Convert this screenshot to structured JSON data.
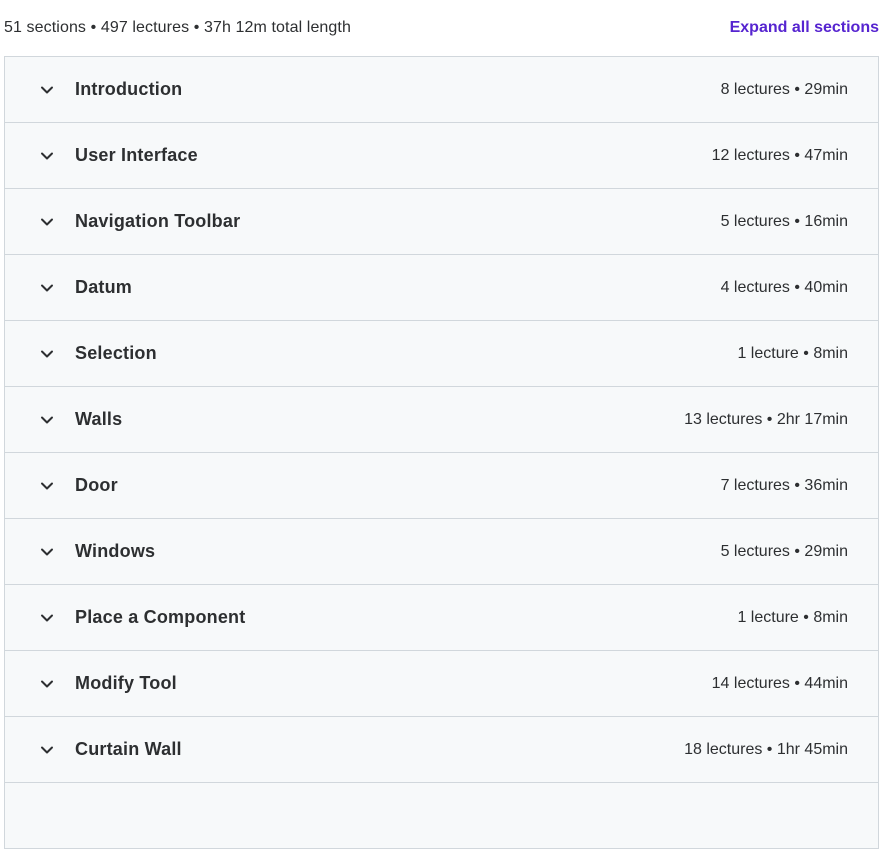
{
  "summary": {
    "text": "51 sections • 497 lectures • 37h 12m total length",
    "expand_label": "Expand all sections"
  },
  "colors": {
    "link": "#5624d0",
    "row_bg": "#f7f9fa",
    "border": "#d1d7dc",
    "text": "#2d2f31"
  },
  "icons": {
    "row_toggle": "chevron-down-icon"
  },
  "sections": [
    {
      "title": "Introduction",
      "meta": "8 lectures • 29min"
    },
    {
      "title": "User Interface",
      "meta": "12 lectures • 47min"
    },
    {
      "title": "Navigation Toolbar",
      "meta": "5 lectures • 16min"
    },
    {
      "title": "Datum",
      "meta": "4 lectures • 40min"
    },
    {
      "title": "Selection",
      "meta": "1 lecture • 8min"
    },
    {
      "title": "Walls",
      "meta": "13 lectures • 2hr 17min"
    },
    {
      "title": "Door",
      "meta": "7 lectures • 36min"
    },
    {
      "title": "Windows",
      "meta": "5 lectures • 29min"
    },
    {
      "title": "Place a Component",
      "meta": "1 lecture • 8min"
    },
    {
      "title": "Modify Tool",
      "meta": "14 lectures • 44min"
    },
    {
      "title": "Curtain Wall",
      "meta": "18 lectures • 1hr 45min"
    },
    {
      "title": "",
      "meta": ""
    }
  ]
}
